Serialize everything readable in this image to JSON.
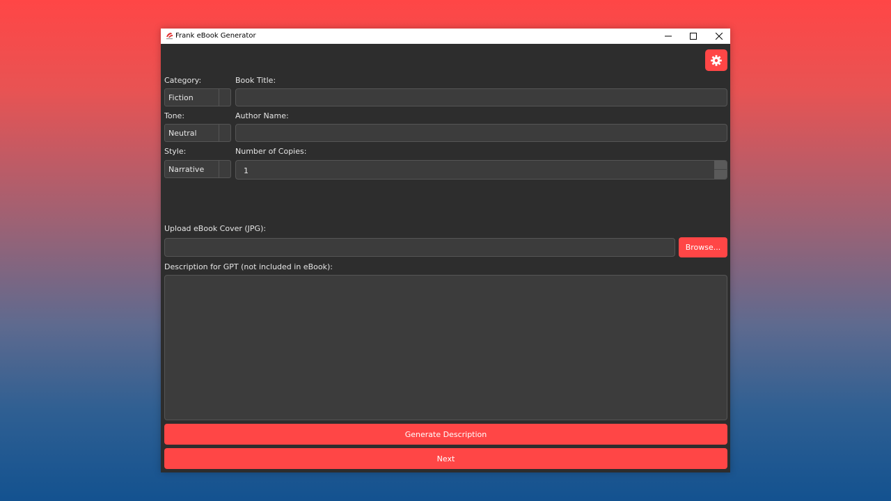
{
  "window": {
    "title": "Frank eBook Generator",
    "accent_color": "#ff4646",
    "icons": {
      "minimize": "minimize-icon",
      "maximize": "maximize-icon",
      "close": "close-icon",
      "settings": "gear-icon"
    }
  },
  "form": {
    "category_label": "Category:",
    "category_value": "Fiction",
    "tone_label": "Tone:",
    "tone_value": "Neutral",
    "style_label": "Style:",
    "style_value": "Narrative",
    "book_title_label": "Book Title:",
    "book_title_value": "",
    "author_label": "Author Name:",
    "author_value": "",
    "copies_label": "Number of Copies:",
    "copies_value": "1",
    "cover_label": "Upload eBook Cover (JPG):",
    "cover_value": "",
    "browse_label": "Browse...",
    "description_label": "Description for GPT (not included in eBook):",
    "description_value": ""
  },
  "actions": {
    "generate_label": "Generate Description",
    "next_label": "Next"
  }
}
